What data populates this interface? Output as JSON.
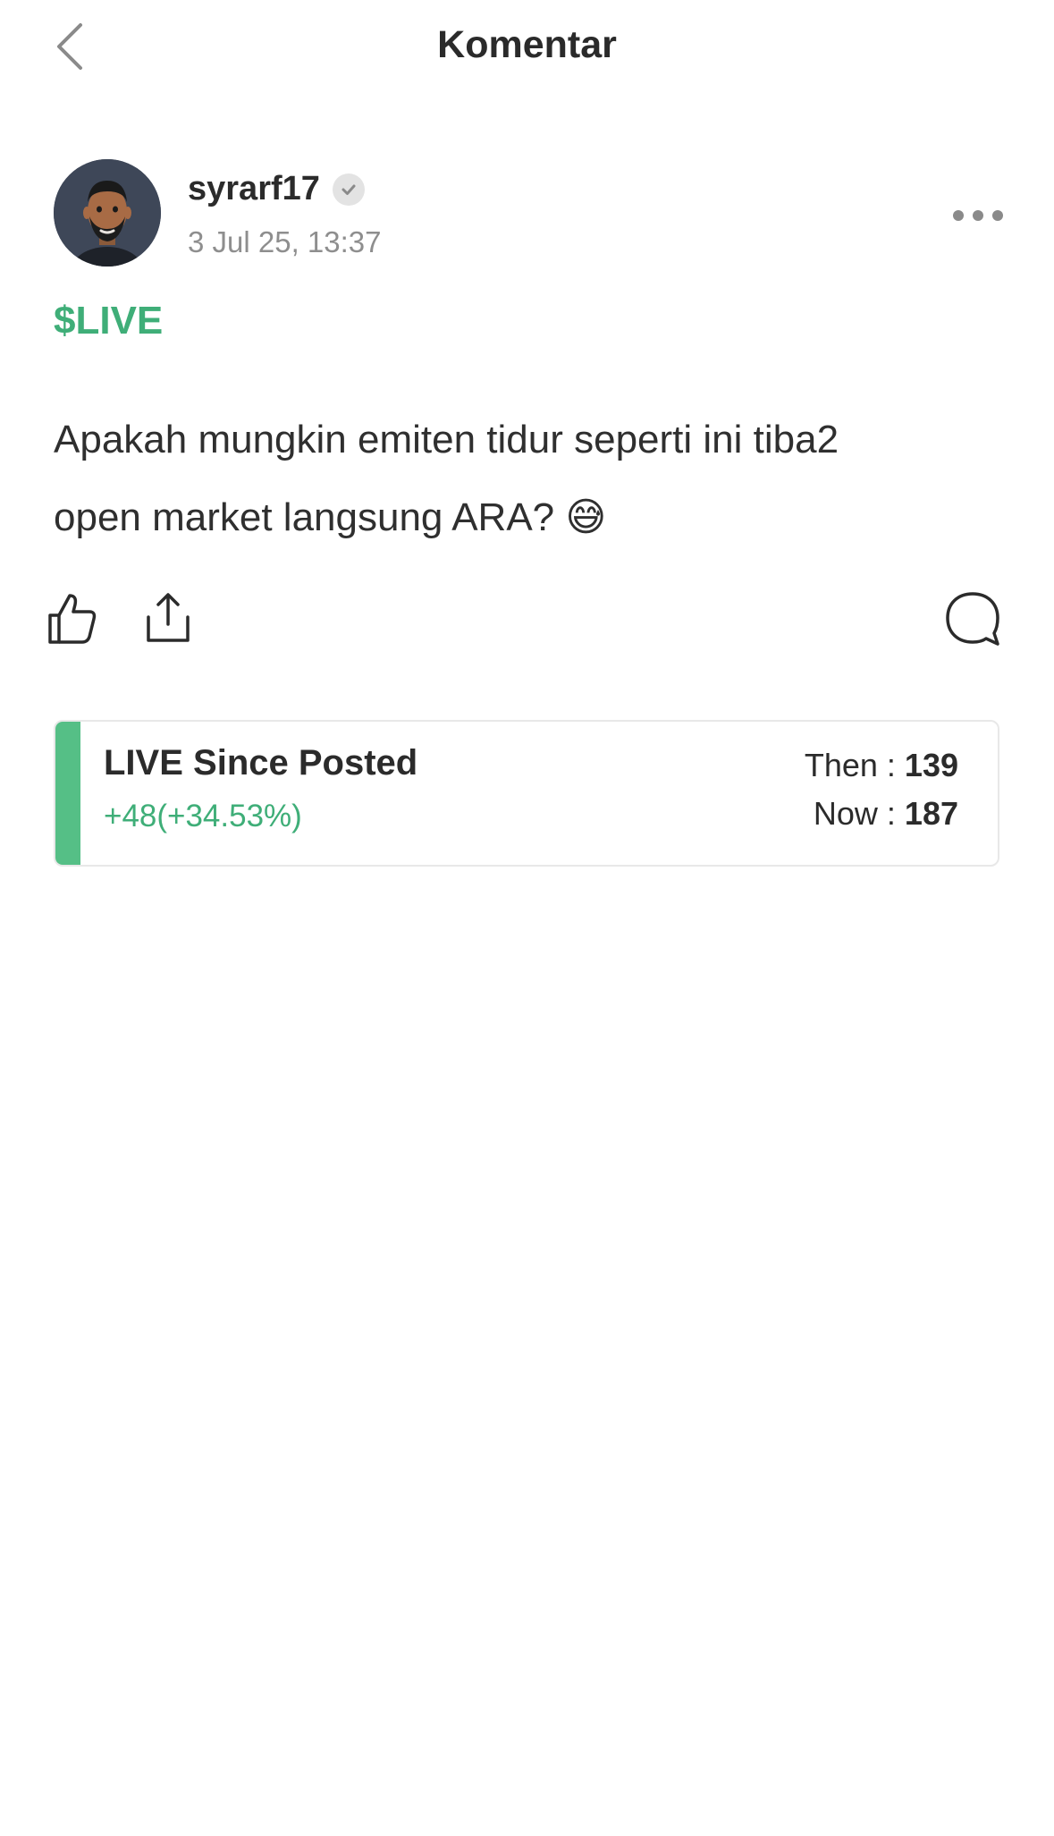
{
  "header": {
    "title": "Komentar"
  },
  "post": {
    "author": {
      "username": "syrarf17",
      "timestamp": "3 Jul 25, 13:37",
      "verified": true
    },
    "ticker": "$LIVE",
    "body_line1": "Apakah mungkin emiten tidur seperti ini tiba2",
    "body_line2": "open market langsung ARA? 😅",
    "actions": [
      "like-icon",
      "share-icon",
      "comment-icon"
    ]
  },
  "performance": {
    "title": "LIVE Since Posted",
    "change": "+48(+34.53%)",
    "then_label": "Then : ",
    "then_value": "139",
    "now_label": "Now : ",
    "now_value": "187",
    "accent_color": "#55bf86"
  },
  "colors": {
    "brand_green": "#3fae78",
    "text_primary": "#2b2b2b",
    "text_muted": "#8e8e8e"
  }
}
